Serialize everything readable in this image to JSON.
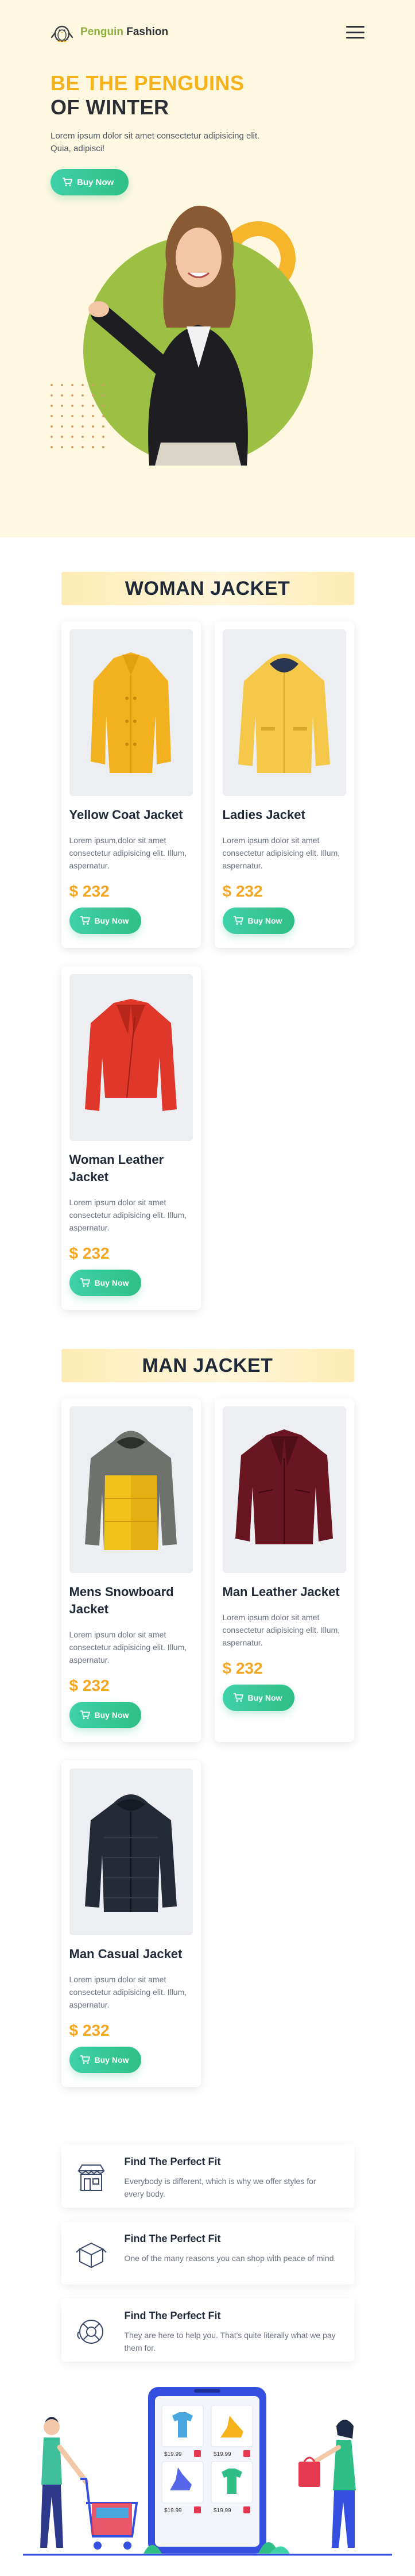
{
  "brand": {
    "name_accent": "Penguin",
    "name_rest": " Fashion",
    "logo_icon": "penguin-logo-icon"
  },
  "nav": {
    "menu_icon": "hamburger-menu-icon"
  },
  "hero": {
    "title_line1": "BE THE PENGUINS",
    "title_line2": "OF WINTER",
    "text": "Lorem ipsum dolor sit amet consectetur adipisicing elit. Quia, adipisci!",
    "button_label": "Buy Now"
  },
  "colors": {
    "accent_yellow": "#f5b21b",
    "brand_green": "#8fb03d",
    "button_green": "#2fbf86",
    "price_orange": "#f5a623",
    "hero_bg": "#fff8e1"
  },
  "woman": {
    "heading": "WOMAN JACKET",
    "products": [
      {
        "title": "Yellow Coat Jacket",
        "desc": "Lorem ipsum,dolor sit amet consectetur adipisicing elit. Illum, aspernatur.",
        "price": "$ 232",
        "button": "Buy Now"
      },
      {
        "title": "Ladies Jacket",
        "desc": "Lorem ipsum dolor sit amet consectetur adipisicing elit. Illum, aspernatur.",
        "price": "$ 232",
        "button": "Buy Now"
      },
      {
        "title": "Woman Leather Jacket",
        "desc": "Lorem ipsum dolor sit amet consectetur adipisicing elit. Illum, aspernatur.",
        "price": "$ 232",
        "button": "Buy Now"
      }
    ]
  },
  "man": {
    "heading": "MAN JACKET",
    "products": [
      {
        "title": "Mens Snowboard Jacket",
        "desc": "Lorem ipsum dolor sit amet consectetur adipisicing elit. Illum, aspernatur.",
        "price": "$ 232",
        "button": "Buy Now"
      },
      {
        "title": "Man Leather Jacket",
        "desc": "Lorem ipsum dolor sit amet consectetur adipisicing elit. Illum, aspernatur.",
        "price": "$ 232",
        "button": "Buy Now"
      },
      {
        "title": "Man Casual Jacket",
        "desc": "Lorem ipsum dolor sit amet consectetur adipisicing elit. Illum, aspernatur.",
        "price": "$ 232",
        "button": "Buy Now"
      }
    ]
  },
  "features": [
    {
      "icon": "shop-icon",
      "title": "Find The Perfect Fit",
      "desc": "Everybody is different, which is why we offer styles for every body."
    },
    {
      "icon": "box-icon",
      "title": "Find The Perfect Fit",
      "desc": "One of the many reasons you can shop with peace of mind."
    },
    {
      "icon": "support-icon",
      "title": "Find The Perfect Fit",
      "desc": "They are here to help you. That's quite literally what we pay them for."
    }
  ],
  "footer_art": {
    "price_left": "$19.99",
    "price_right": "$19.99",
    "price_bottom_left": "$19.99",
    "price_bottom_right": "$19.99"
  }
}
